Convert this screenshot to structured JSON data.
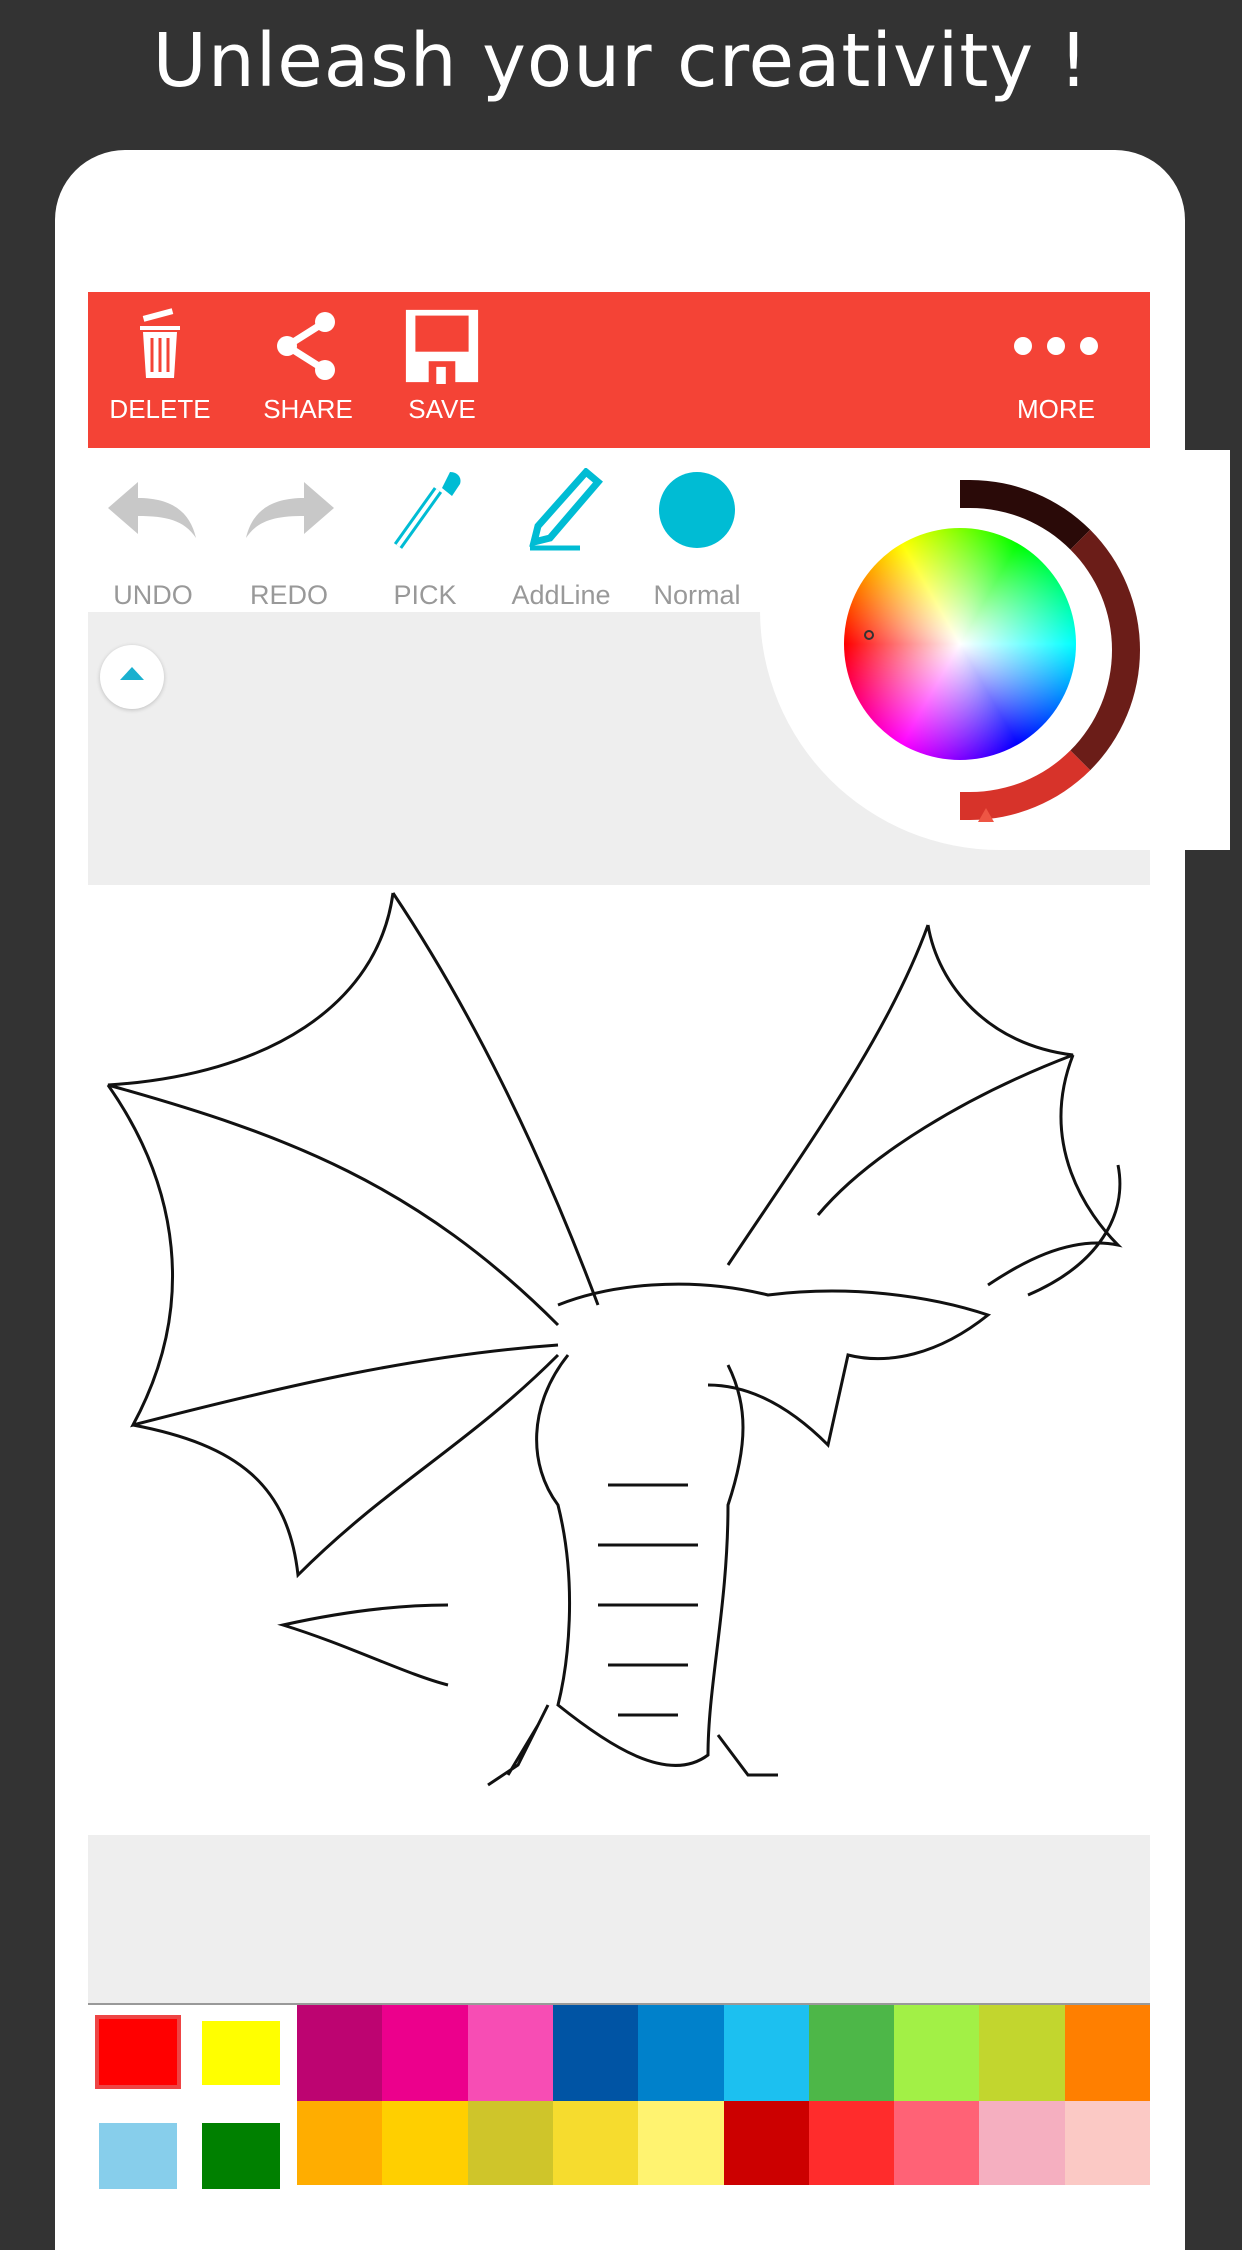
{
  "banner": {
    "title": "Unleash your creativity !"
  },
  "toolbar": {
    "delete": "DELETE",
    "share": "SHARE",
    "save": "SAVE",
    "more": "MORE",
    "color": "#f44336"
  },
  "tools": {
    "undo": "UNDO",
    "redo": "REDO",
    "pick": "PICK",
    "addline": "AddLine",
    "normal": "Normal",
    "accent": "#00bcd4"
  },
  "palette": {
    "recent": [
      "#ff0000",
      "#ffff00",
      "#87ceeb",
      "#008000"
    ],
    "selected": "#ff0000",
    "grid": [
      "#bd0471",
      "#ec008c",
      "#f74db4",
      "#0054a4",
      "#0081cb",
      "#1cc0f0",
      "#4db748",
      "#a2f046",
      "#c2d62e",
      "#ff7f00",
      "#ffad00",
      "#ffcf00",
      "#cfc52a",
      "#f6dc2e",
      "#fff370",
      "#cc0000",
      "#ff2c2c",
      "#ff6276",
      "#f5afc0",
      "#fbc9c5"
    ]
  }
}
